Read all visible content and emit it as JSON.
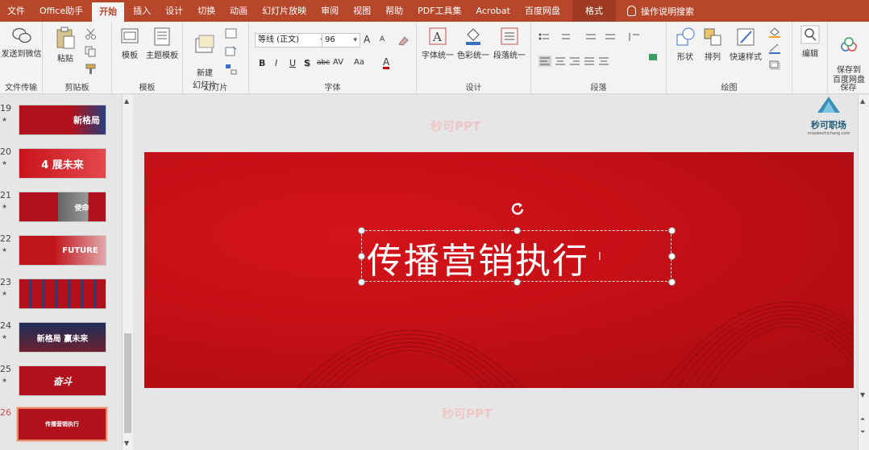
{
  "menu": {
    "items": [
      "文件",
      "Office助手",
      "开始",
      "插入",
      "设计",
      "切换",
      "动画",
      "幻灯片放映",
      "审阅",
      "视图",
      "帮助",
      "PDF工具集",
      "Acrobat",
      "百度网盘"
    ],
    "active_index": 2,
    "format_tab": "格式",
    "search_label": "操作说明搜索"
  },
  "ribbon": {
    "file_transfer": {
      "button": "发送到微信",
      "group": "文件传输"
    },
    "clipboard": {
      "paste": "粘贴",
      "group": "剪贴板"
    },
    "templates": {
      "template": "模板",
      "theme_template": "主题模板",
      "group": "模板"
    },
    "slides": {
      "new_slide": "新建\n幻灯片",
      "group": "幻灯片"
    },
    "font": {
      "font_name": "等线 (正文)",
      "font_size": "96",
      "bold": "B",
      "italic": "I",
      "underline": "U",
      "shadow": "S",
      "strike": "abc",
      "spacing": "AV",
      "case": "Aa",
      "color": "A",
      "grow": "A",
      "shrink": "A",
      "group": "字体"
    },
    "design": {
      "font_unify": "字体统一",
      "color_unify": "色彩统一",
      "para_unify": "段落统一",
      "group": "设计"
    },
    "paragraph": {
      "group": "段落"
    },
    "drawing": {
      "shape": "形状",
      "arrange": "排列",
      "quick_style": "快速样式",
      "group": "绘图"
    },
    "editing": {
      "edit": "编辑"
    },
    "save": {
      "button": "保存到\n百度网盘",
      "group": "保存"
    }
  },
  "slides_panel": {
    "items": [
      {
        "num": "19",
        "text": "新格局"
      },
      {
        "num": "20",
        "text": "4 展未来"
      },
      {
        "num": "21",
        "text": "使命"
      },
      {
        "num": "22",
        "text": "FUTURE"
      },
      {
        "num": "23",
        "text": ""
      },
      {
        "num": "24",
        "text": "新格局 赢未来"
      },
      {
        "num": "25",
        "text": "奋斗"
      },
      {
        "num": "26",
        "text": "传播营销执行"
      }
    ],
    "current": "26"
  },
  "slide": {
    "title": "传播营销执行",
    "watermark": "秒可PPT"
  },
  "logo": {
    "name": "秒可职场",
    "sub": "miaokezhichang.com"
  },
  "colors": {
    "menubar": "#b7472a",
    "slide_red": "#c40f16",
    "accent": "#c0504d"
  }
}
